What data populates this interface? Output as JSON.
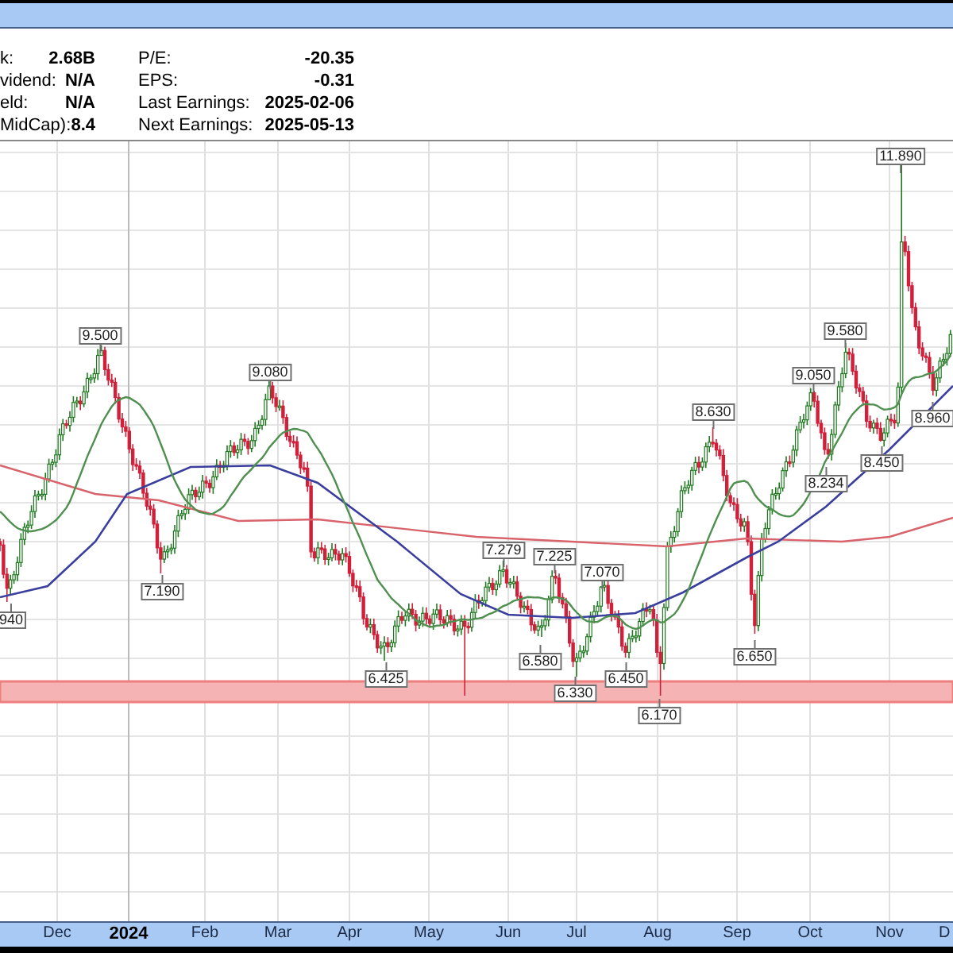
{
  "stats_left": [
    {
      "label": "k:",
      "value": "2.68B"
    },
    {
      "label": "vidend:",
      "value": "N/A"
    },
    {
      "label": "eld:",
      "value": "N/A"
    },
    {
      "label": "MidCap):",
      "value": "8.4"
    }
  ],
  "stats_right": [
    {
      "label": "P/E:",
      "value": "-20.35"
    },
    {
      "label": "EPS:",
      "value": "-0.31"
    },
    {
      "label": "Last Earnings:",
      "value": "2025-02-06"
    },
    {
      "label": "Next Earnings:",
      "value": "2025-05-13"
    }
  ],
  "price_labels": [
    {
      "text": "940"
    },
    {
      "text": "9.500"
    },
    {
      "text": "7.190"
    },
    {
      "text": "9.080"
    },
    {
      "text": "6.425"
    },
    {
      "text": "7.279"
    },
    {
      "text": "6.580"
    },
    {
      "text": "7.225"
    },
    {
      "text": "6.330"
    },
    {
      "text": "7.070"
    },
    {
      "text": "6.450"
    },
    {
      "text": "6.170"
    },
    {
      "text": "8.630"
    },
    {
      "text": "6.650"
    },
    {
      "text": "8.234"
    },
    {
      "text": "9.050"
    },
    {
      "text": "9.580"
    },
    {
      "text": "8.450"
    },
    {
      "text": "11.890"
    },
    {
      "text": "8.960"
    }
  ],
  "x_axis_labels": [
    {
      "text": "Dec",
      "bold": false
    },
    {
      "text": "2024",
      "bold": true
    },
    {
      "text": "Feb",
      "bold": false
    },
    {
      "text": "Mar",
      "bold": false
    },
    {
      "text": "Apr",
      "bold": false
    },
    {
      "text": "May",
      "bold": false
    },
    {
      "text": "Jun",
      "bold": false
    },
    {
      "text": "Jul",
      "bold": false
    },
    {
      "text": "Aug",
      "bold": false
    },
    {
      "text": "Sep",
      "bold": false
    },
    {
      "text": "Oct",
      "bold": false
    },
    {
      "text": "Nov",
      "bold": false
    },
    {
      "text": "D",
      "bold": false
    }
  ]
}
